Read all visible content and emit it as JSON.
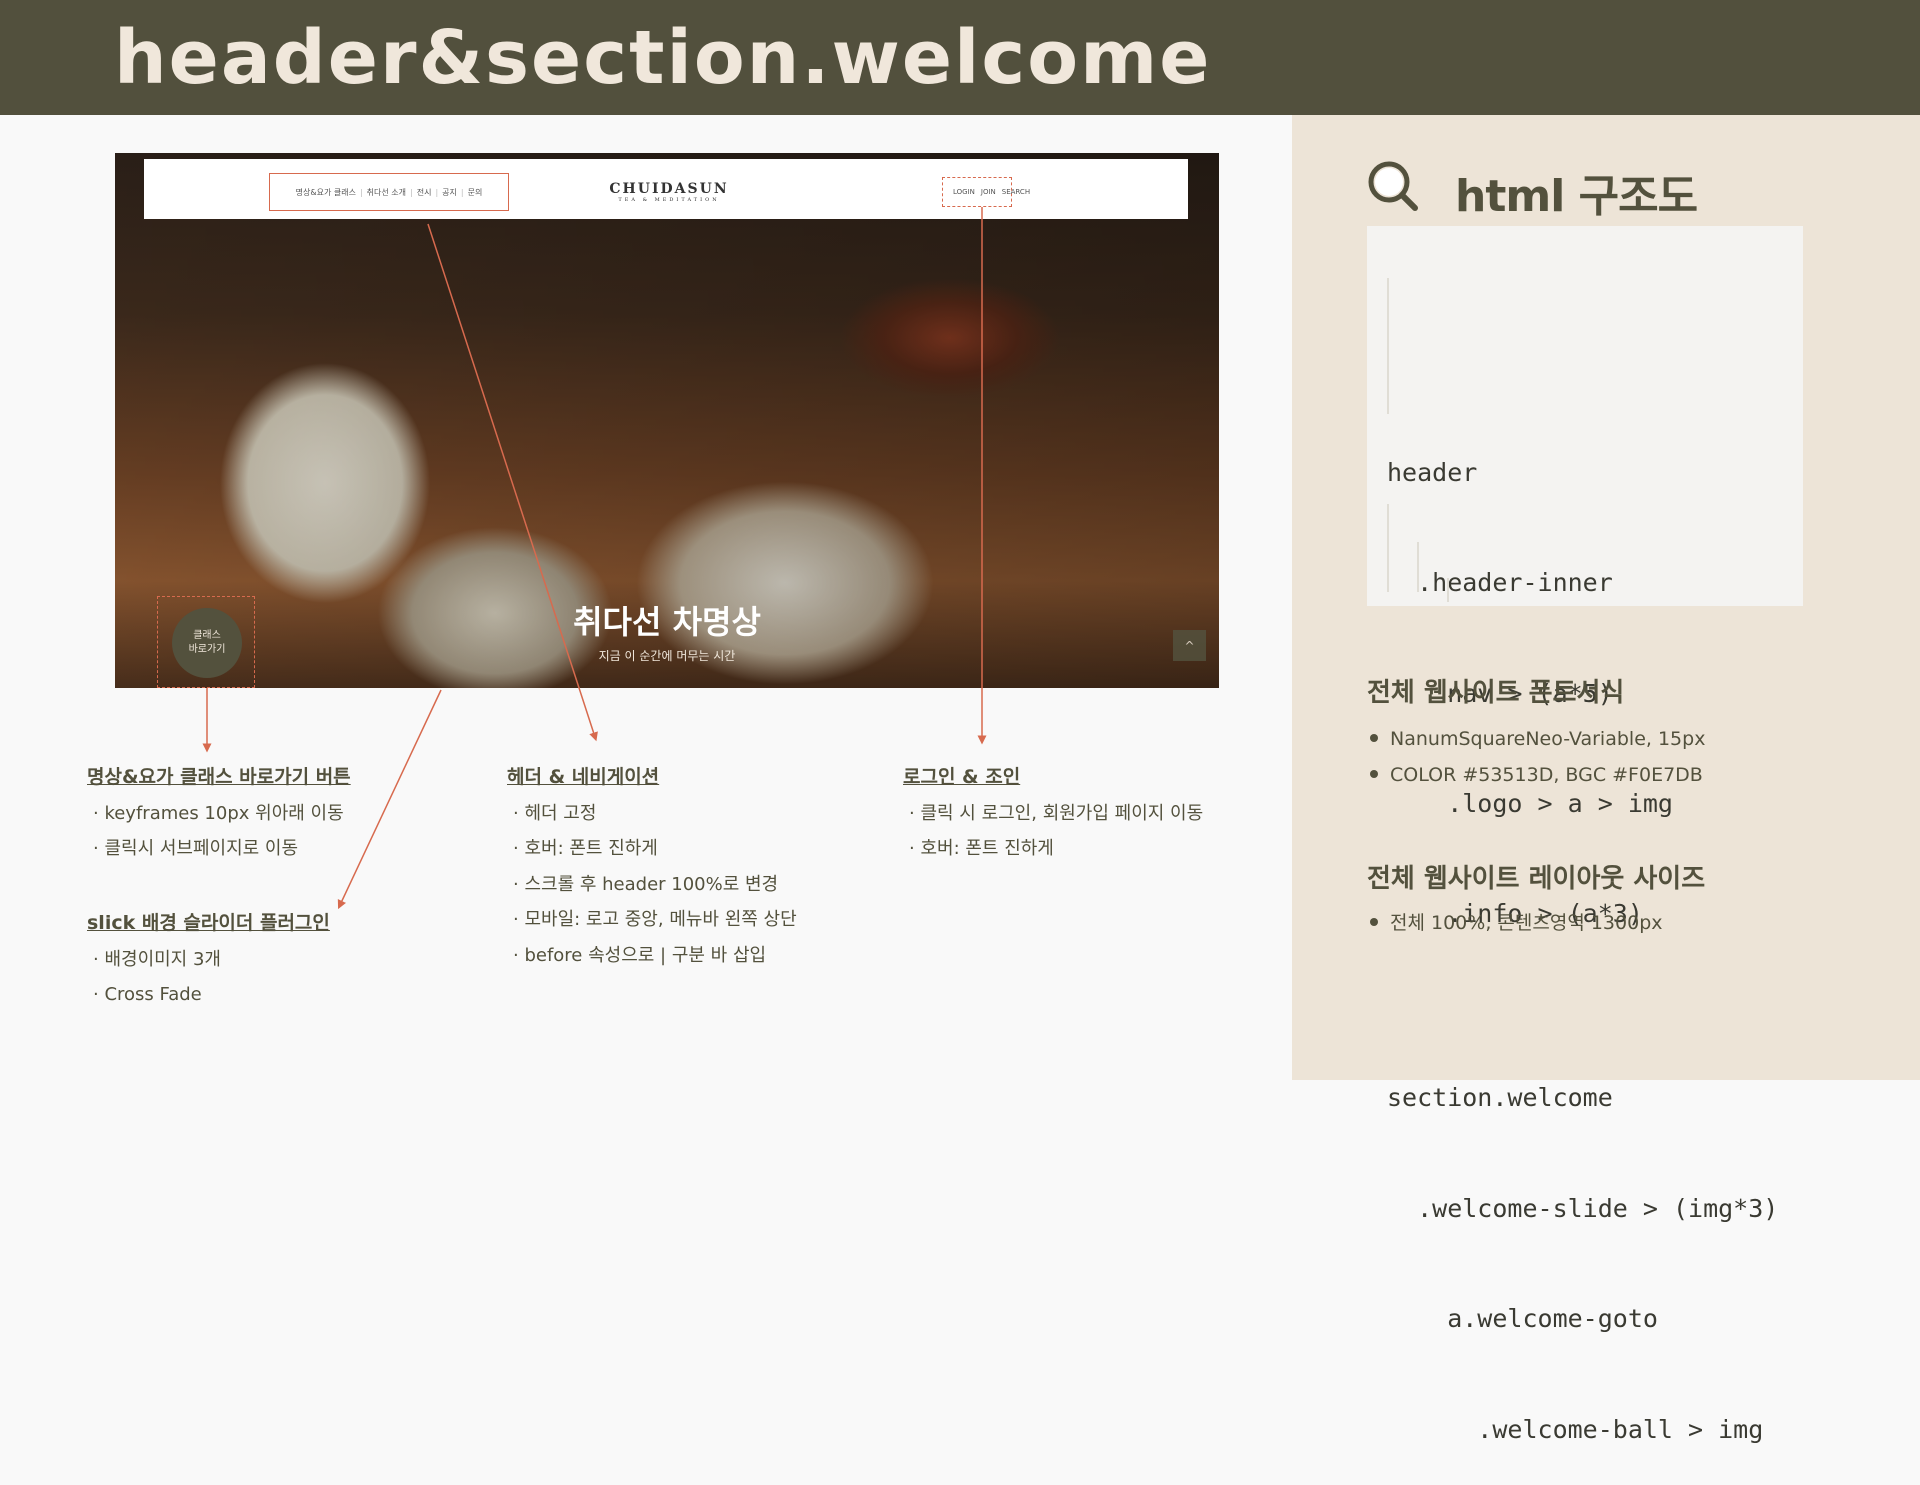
{
  "title": "header&section.welcome",
  "mockup": {
    "nav": [
      "명상&요가 클래스",
      "취다선 소개",
      "전시",
      "공지",
      "문의"
    ],
    "logo_main": "CHUIDASUN",
    "logo_sub": "TEA & MEDITATION",
    "info": [
      "LOGIN",
      "JOIN",
      "SEARCH"
    ],
    "hero_title": "취다선 차명상",
    "hero_sub": "지금 이 순간에 머무는 시간",
    "ball_line1": "클래스",
    "ball_line2": "바로가기",
    "top_button": "^"
  },
  "notes": {
    "ball": {
      "heading": "명상&요가 클래스 바로가기 버튼",
      "items": [
        "· keyframes 10px 위아래 이동",
        "· 클릭시 서브페이지로 이동"
      ]
    },
    "slick": {
      "heading": "slick 배경 슬라이더 플러그인",
      "items": [
        "· 배경이미지 3개",
        "· Cross Fade"
      ]
    },
    "header": {
      "heading": "헤더 & 네비게이션",
      "items": [
        "· 헤더 고정",
        "· 호버: 폰트 진하게",
        "· 스크롤 후 header 100%로 변경",
        "· 모바일: 로고 중앙, 메뉴바 왼쪽 상단",
        "· before 속성으로 | 구분 바 삽입"
      ]
    },
    "login": {
      "heading": "로그인 & 조인",
      "items": [
        "· 클릭 시 로그인, 회원가입 페이지 이동",
        "· 호버: 폰트 진하게"
      ]
    }
  },
  "panel": {
    "title": "html 구조도",
    "code": [
      "header",
      "  .header-inner",
      "    nav > (a*5)",
      "    .logo > a > img",
      "    .info > (a*3)",
      "",
      "section.welcome",
      "  .welcome-slide > (img*3)",
      "    a.welcome-goto",
      "      .welcome-ball > img"
    ],
    "font_heading": "전체 웹사이트 폰트서식",
    "font_items": [
      "NanumSquareNeo-Variable, 15px",
      "COLOR #53513D, BGC #F0E7DB"
    ],
    "layout_heading": "전체 웹사이트 레이아웃 사이즈",
    "layout_items": [
      "전체 100%, 콘텐츠영역 1300px"
    ]
  },
  "colors": {
    "brand": "#53513d",
    "cream": "#f0e7db",
    "accent": "#d76a4e"
  }
}
